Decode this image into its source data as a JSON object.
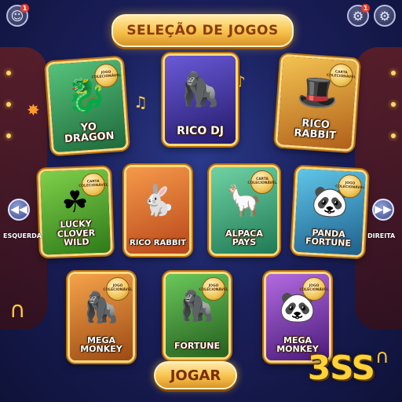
{
  "header": {
    "title": "SELEÇÃO DE JOGOS",
    "avatar_icon": "user-icon",
    "notification_count": "1",
    "settings_badge_count": "1",
    "settings_icon": "gear-icon"
  },
  "badges": {
    "jogo_colecionavel": "JOGO COLECIONÁVEL",
    "carta_colecionavel": "CARTA COLECIONÁVEL"
  },
  "games": [
    {
      "title": "YO\nDRAGON",
      "icon": "dragon",
      "bg": "#2f8f55",
      "badge": "JOGO COLECIONÁVEL"
    },
    {
      "title": "RICO  DJ",
      "icon": "gorilla-dj",
      "bg": "#3a2c9a",
      "badge": ""
    },
    {
      "title": "RICO\nRABBIT",
      "icon": "rabbit-top-hat",
      "bg": "#c77a1f",
      "badge": "CARTA COLECIONÁVEL"
    },
    {
      "title": "LUCKY\nCLOVER\nWILD",
      "icon": "clover",
      "bg": "#4a9a2a",
      "badge": "CARTA COLECIONÁVEL"
    },
    {
      "title": "RICO RABBIT",
      "icon": "rabbit",
      "bg": "#d8742a",
      "badge": ""
    },
    {
      "title": "ALPACA\nPAYS",
      "icon": "alpaca",
      "bg": "#3aa07a",
      "badge": "CARTA COLECIONÁVEL"
    },
    {
      "title": "PANDA\nFORTUNE",
      "icon": "panda",
      "bg": "#2a8ab0",
      "badge": "JOGO COLECIONÁVEL"
    },
    {
      "title": "MEGA\nMONKEY",
      "icon": "gorilla",
      "bg": "#c9651f",
      "badge": "JOGO COLECIONÁVEL"
    },
    {
      "title": "FORTUNE",
      "icon": "gorilla-banana",
      "bg": "#3f8f35",
      "badge": "JOGO COLECIONÁVEL"
    },
    {
      "title": "MEGA\nMONKEY",
      "icon": "panda-banana",
      "bg": "#7a3aa0",
      "badge": "JOGO COLECIONÁVEL"
    }
  ],
  "nav": {
    "left_label": "ESQUERDA",
    "right_label": "DIREITA",
    "left_icon": "rewind-icon",
    "right_icon": "fast-forward-icon"
  },
  "play_button": "JOGAR",
  "brand": "3SS",
  "colors": {
    "gold": "#f6c24a",
    "background": "#1a1f5a"
  }
}
